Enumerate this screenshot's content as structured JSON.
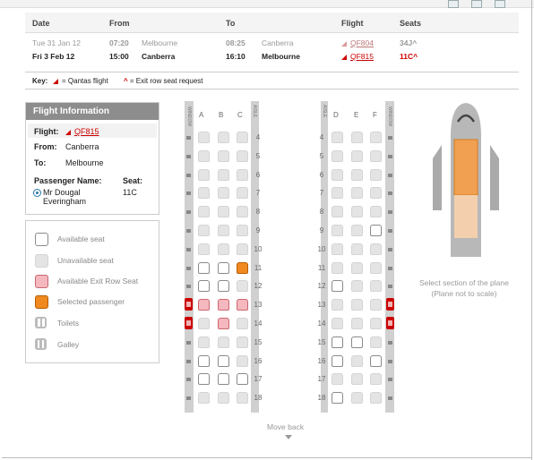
{
  "flights": {
    "headers": [
      "Date",
      "From",
      "To",
      "Flight",
      "Seats"
    ],
    "rows": [
      {
        "date": "Tue 31 Jan 12",
        "dep_time": "07:20",
        "from": "Melbourne",
        "arr_time": "08:25",
        "to": "Canberra",
        "flight": "QF804",
        "seats": "34J",
        "dim": true
      },
      {
        "date": "Fri 3 Feb 12",
        "dep_time": "15:00",
        "from": "Canberra",
        "arr_time": "16:10",
        "to": "Melbourne",
        "flight": "QF815",
        "seats": "11C",
        "dim": false
      }
    ]
  },
  "key": {
    "label": "Key:",
    "qantas": "= Qantas flight",
    "exit": "= Exit row seat request"
  },
  "info": {
    "title": "Flight Information",
    "flight_label": "Flight:",
    "flight": "QF815",
    "from_label": "From:",
    "from": "Canberra",
    "to_label": "To:",
    "to": "Melbourne",
    "passenger_label": "Passenger Name:",
    "seat_label": "Seat:",
    "passenger": "Mr Dougal Everingham",
    "seat": "11C"
  },
  "legend": [
    {
      "icon": "available-seat-icon",
      "label": "Available seat"
    },
    {
      "icon": "unavailable-seat-icon",
      "label": "Unavailable seat"
    },
    {
      "icon": "exit-row-seat-icon",
      "label": "Available Exit Row Seat"
    },
    {
      "icon": "selected-passenger-icon",
      "label": "Selected passenger"
    },
    {
      "icon": "toilets-icon",
      "label": "Toilets"
    },
    {
      "icon": "galley-icon",
      "label": "Galley"
    }
  ],
  "seatmap": {
    "columns_left": [
      "A",
      "B",
      "C"
    ],
    "columns_right": [
      "D",
      "E",
      "F"
    ],
    "window_label": "WINDOW",
    "aisle_label": "AISLE",
    "rows": [
      {
        "n": "4",
        "l": "uuu",
        "r": "uuu"
      },
      {
        "n": "5",
        "l": "uuu",
        "r": "uuu"
      },
      {
        "n": "6",
        "l": "uuu",
        "r": "uuu"
      },
      {
        "n": "7",
        "l": "uuu",
        "r": "uuu"
      },
      {
        "n": "8",
        "l": "uuu",
        "r": "uuu"
      },
      {
        "n": "9",
        "l": "uuu",
        "r": "uua"
      },
      {
        "n": "10",
        "l": "uuu",
        "r": "uuu"
      },
      {
        "n": "11",
        "l": "aas",
        "r": "uuu"
      },
      {
        "n": "12",
        "l": "aau",
        "r": "auu"
      },
      {
        "n": "13",
        "l": "xxx",
        "r": "uuu",
        "exit": true
      },
      {
        "n": "14",
        "l": "uxu",
        "r": "uuu",
        "exit": true
      },
      {
        "n": "15",
        "l": "uuu",
        "r": "aau"
      },
      {
        "n": "16",
        "l": "aau",
        "r": "aua"
      },
      {
        "n": "17",
        "l": "aaa",
        "r": "uuu"
      },
      {
        "n": "18",
        "l": "uuu",
        "r": "auu"
      }
    ]
  },
  "move_back": "Move back",
  "plane_caption_1": "Select section of the plane",
  "plane_caption_2": "(Plane not to scale)",
  "colors": {
    "qantas_red": "#cc0000",
    "selected": "#f08a20",
    "exit_seat": "#f5b8be",
    "section_highlight": "#f0a050"
  }
}
